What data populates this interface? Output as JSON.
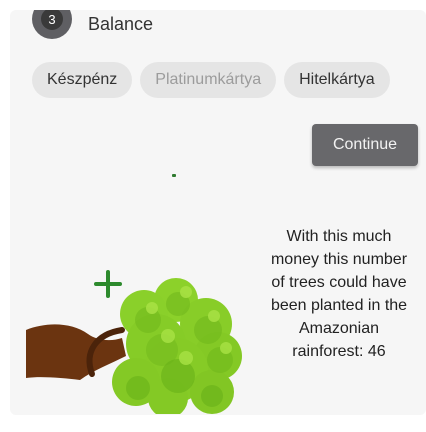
{
  "header": {
    "step": "3",
    "title": "Balance"
  },
  "payment_options": [
    {
      "label": "Készpénz",
      "state": "enabled"
    },
    {
      "label": "Platinumkártya",
      "state": "disabled"
    },
    {
      "label": "Hitelkártya",
      "state": "enabled"
    }
  ],
  "actions": {
    "continue_label": "Continue"
  },
  "info": {
    "text": "With this much money this number of trees could have been planted in the Amazonian rainforest: 46"
  },
  "illustration": {
    "icons": [
      "plus-icon",
      "tree-icon"
    ]
  },
  "colors": {
    "button": "#68686b",
    "chip": "#e5e5e5",
    "tree_green": "#8cd12a",
    "trunk": "#6b3410"
  }
}
